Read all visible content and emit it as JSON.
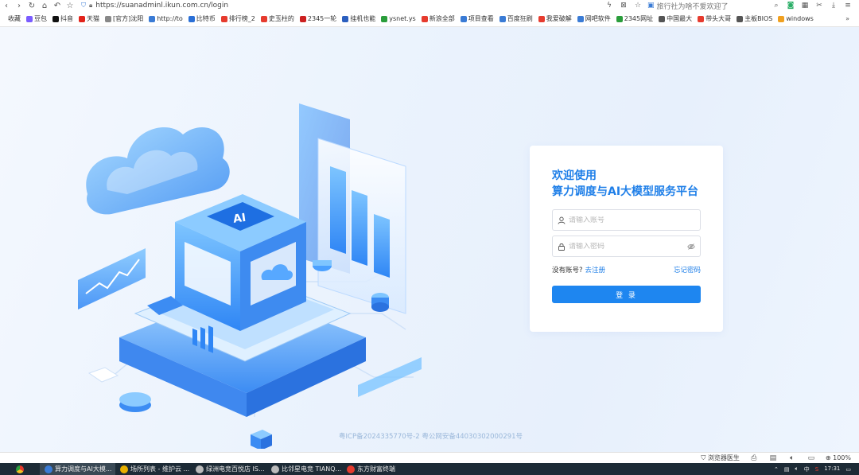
{
  "browser": {
    "url": "https://suanadminl.ikun.com.cn/login",
    "search_suggestion": "旅行社为啥不爱欢迎了",
    "bookmarks": [
      {
        "label": "收藏",
        "color": "#ffffff"
      },
      {
        "label": "豆包",
        "color": "#7a5cff"
      },
      {
        "label": "抖音",
        "color": "#111111"
      },
      {
        "label": "天猫",
        "color": "#e2231a"
      },
      {
        "label": "[官方]沈阳",
        "color": "#888888"
      },
      {
        "label": "http://to",
        "color": "#3a7bd5"
      },
      {
        "label": "比特币",
        "color": "#2a6fd6"
      },
      {
        "label": "排行榜_2",
        "color": "#e63b2e"
      },
      {
        "label": "史玉柱的",
        "color": "#e63b2e"
      },
      {
        "label": "2345一轮",
        "color": "#cc2020"
      },
      {
        "label": "挂机也能",
        "color": "#2b5fbf"
      },
      {
        "label": "ysnet.ys",
        "color": "#2a9d3b"
      },
      {
        "label": "新浪全部",
        "color": "#e63b2e"
      },
      {
        "label": "项目查看",
        "color": "#3a7bd5"
      },
      {
        "label": "百度狂刷",
        "color": "#3a7bd5"
      },
      {
        "label": "我爱破解",
        "color": "#e63b2e"
      },
      {
        "label": "网吧软件",
        "color": "#3a7bd5"
      },
      {
        "label": "2345网址",
        "color": "#2a9d3b"
      },
      {
        "label": "中国最大",
        "color": "#555555"
      },
      {
        "label": "带头大哥",
        "color": "#e63b2e"
      },
      {
        "label": "主板BIOS",
        "color": "#555555"
      },
      {
        "label": "windows",
        "color": "#f0a020"
      }
    ],
    "bookmarks_more": "»",
    "status": {
      "security_label": "浏览器医生",
      "zoom": "100%"
    }
  },
  "login": {
    "title_line1": "欢迎使用",
    "title_line2": "算力调度与AI大模型服务平台",
    "account_placeholder": "请输入账号",
    "password_placeholder": "请输入密码",
    "no_account": "没有账号?",
    "register": "去注册",
    "forgot": "忘记密码",
    "submit": "登 录"
  },
  "footer": {
    "icp": "粤ICP备2024335770号-2 粤公网安备44030302000291号"
  },
  "taskbar": {
    "items": [
      {
        "label": "算力调度与AI大模...",
        "color": "#3a7bd5",
        "active": true
      },
      {
        "label": "场所列表 - 维护云 ...",
        "color": "#e8b000",
        "active": false
      },
      {
        "label": "绿洲电竞百悦店 IS...",
        "color": "#bbbbbb",
        "active": false
      },
      {
        "label": "比邻星电竞 TIANQ...",
        "color": "#bbbbbb",
        "active": false
      },
      {
        "label": "东方财富终端",
        "color": "#e63b2e",
        "active": false
      }
    ],
    "tray_lang": "中",
    "clock_time": "17:31"
  }
}
